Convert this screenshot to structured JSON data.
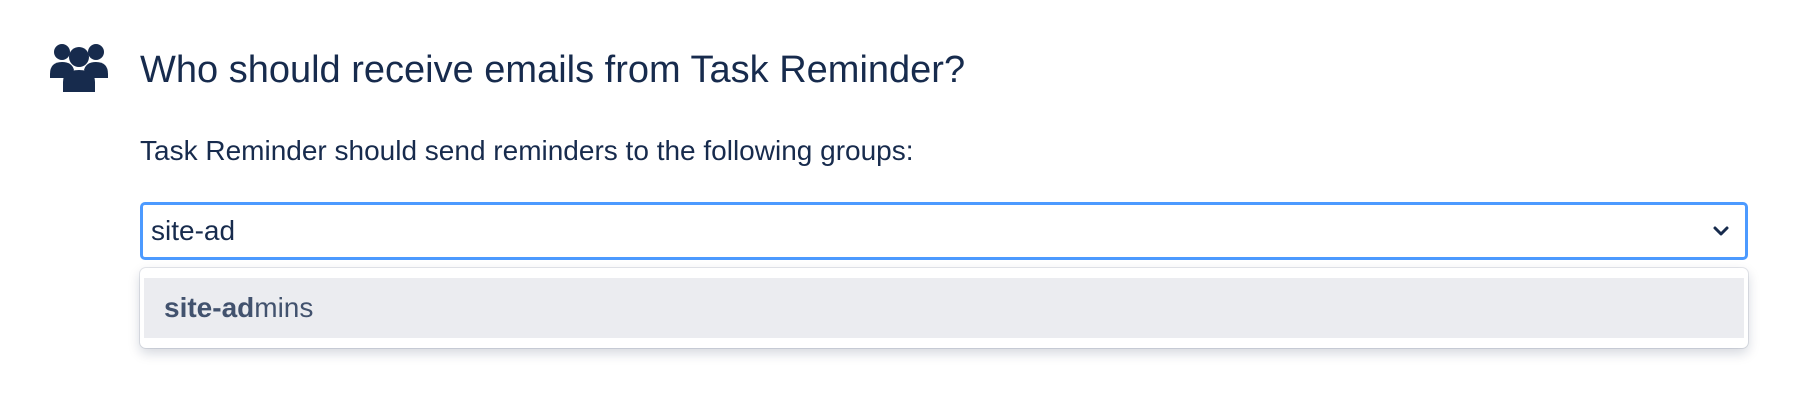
{
  "section": {
    "icon": "people-group-icon",
    "title": "Who should receive emails from Task Reminder?",
    "description": "Task Reminder should send reminders to the following groups:"
  },
  "group_select": {
    "value": "site-ad",
    "toggle_icon": "chevron-down-icon",
    "focus_color": "#4c9aff",
    "options": [
      {
        "match": "site-ad",
        "rest": "mins"
      }
    ]
  },
  "colors": {
    "text_primary": "#172b4d",
    "text_option": "#42526e",
    "option_highlight": "#ebecf0"
  }
}
